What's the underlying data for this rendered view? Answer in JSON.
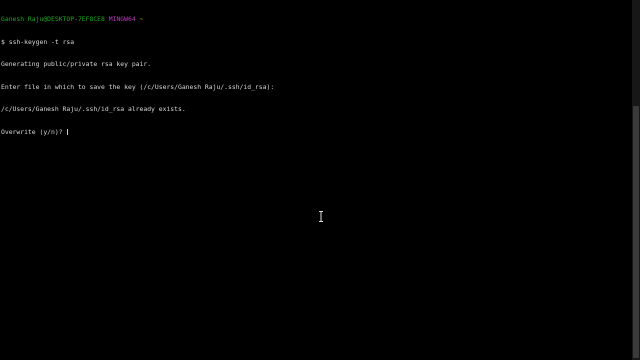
{
  "prompt": {
    "user_host": "Ganesh Raju@DESKTOP-7EF8CE8",
    "shell": "MINGW64",
    "path": "~"
  },
  "command": {
    "symbol": "$",
    "text": "ssh-keygen -t rsa"
  },
  "output": {
    "line1": "Generating public/private rsa key pair.",
    "line2": "Enter file in which to save the key (/c/Users/Ganesh Raju/.ssh/id_rsa):",
    "line3": "/c/Users/Ganesh Raju/.ssh/id_rsa already exists.",
    "line4": "Overwrite (y/n)? "
  },
  "colors": {
    "background": "#000000",
    "user_host": "#21a421",
    "shell": "#b93bb9",
    "path": "#c8b11e",
    "text": "#d7d7d7"
  },
  "icons": {
    "mouse_pointer": "ibeam-cursor-icon"
  }
}
